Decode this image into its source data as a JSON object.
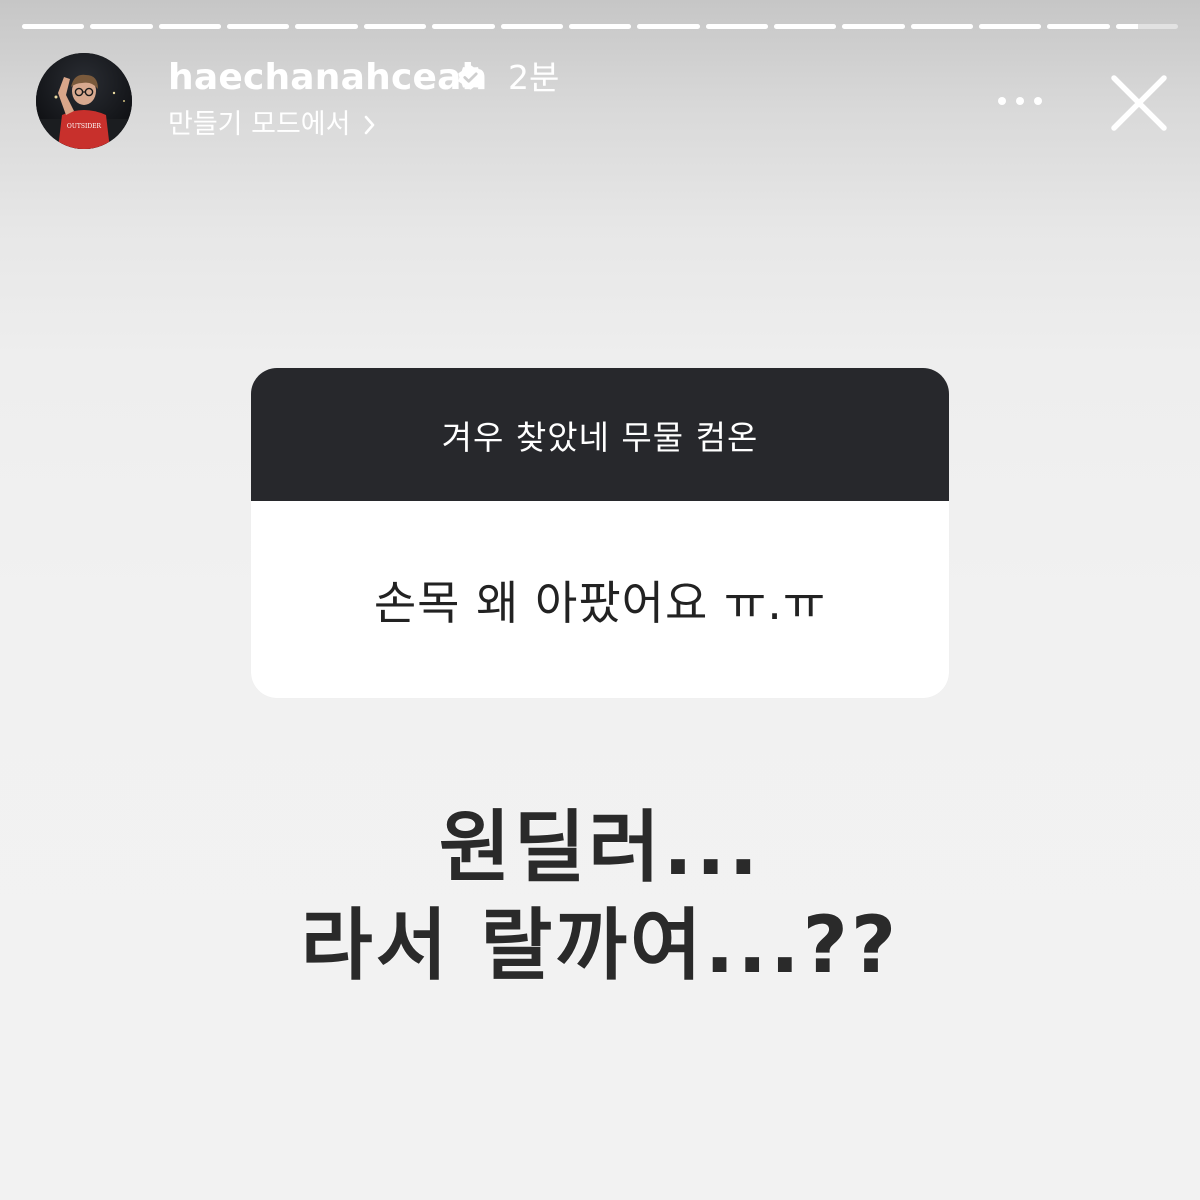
{
  "story": {
    "segment_count": 17,
    "current_segment": 16,
    "current_segment_progress": 0.35
  },
  "header": {
    "username": "haechanahceah",
    "verified": true,
    "time_ago": "2분",
    "subtitle": "만들기 모드에서",
    "avatar_shirt_text": "OUTSIDER",
    "icons": {
      "verified": "verified-badge-icon",
      "subtitle_chevron": "chevron-right-icon",
      "more": "more-options-icon",
      "close": "close-icon"
    }
  },
  "question_card": {
    "prompt": "겨우 찾았네 무물 컴온",
    "question": "손목 왜 아팠어요 ㅠ.ㅠ",
    "header_color": "#27282c",
    "body_color": "#ffffff"
  },
  "answer": {
    "line1": "원딜러...",
    "line2": "라서 랄까여...??"
  }
}
